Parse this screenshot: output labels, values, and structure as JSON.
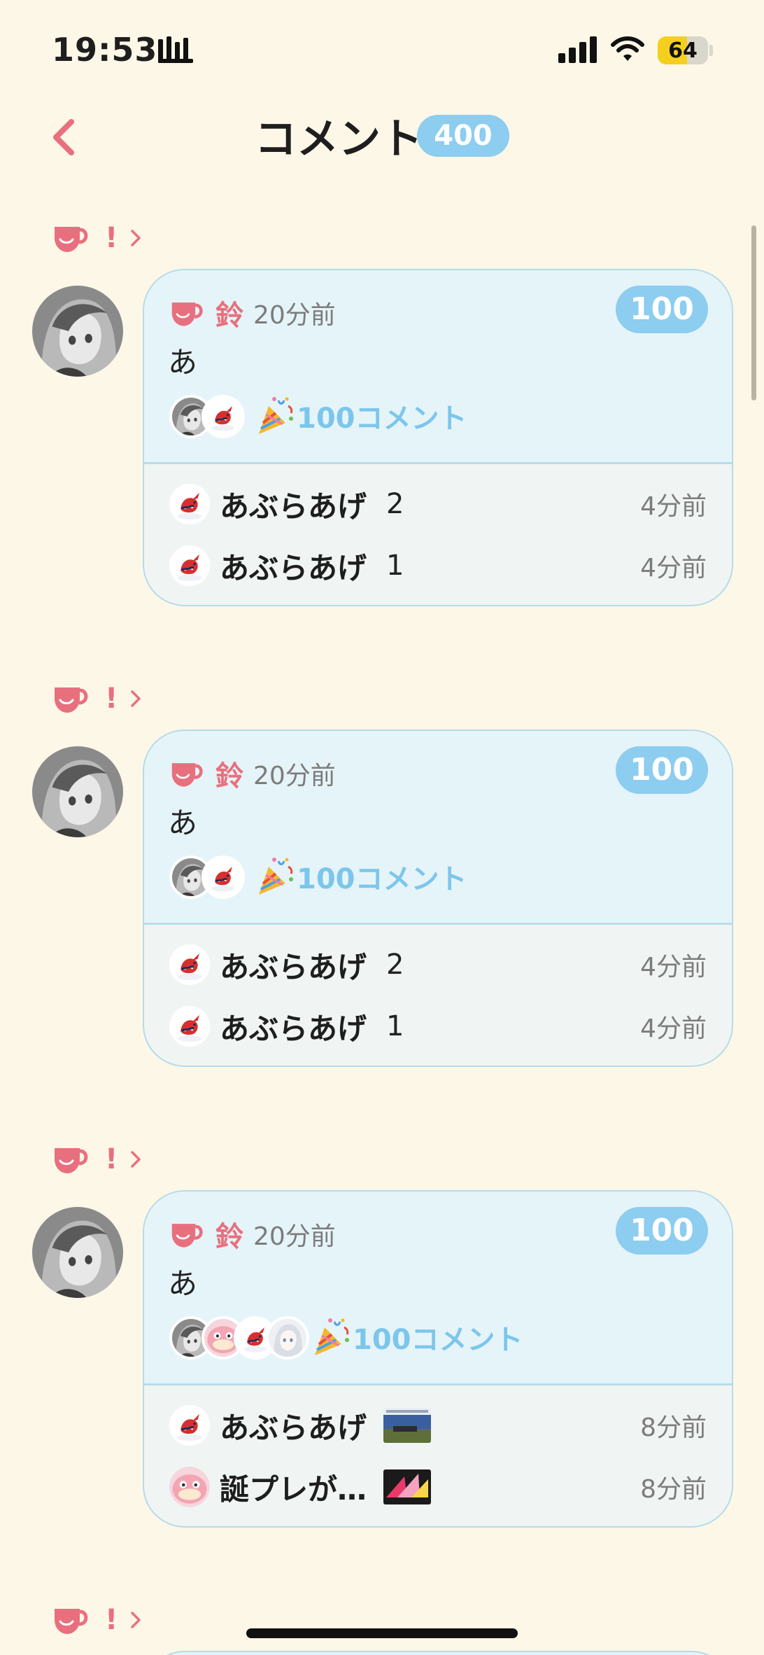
{
  "status_bar": {
    "time": "19:53",
    "battery": "64"
  },
  "header": {
    "title": "コメント",
    "count": "400"
  },
  "threads": [
    {
      "author": "鈴",
      "time_ago": "20分前",
      "likes": "100",
      "text": "あ",
      "milestone": "100コメント",
      "replies": [
        {
          "name": "あぶらあげ",
          "text": "2",
          "time": "4分前"
        },
        {
          "name": "あぶらあげ",
          "text": "1",
          "time": "4分前"
        }
      ]
    },
    {
      "author": "鈴",
      "time_ago": "20分前",
      "likes": "100",
      "text": "あ",
      "milestone": "100コメント",
      "replies": [
        {
          "name": "あぶらあげ",
          "text": "2",
          "time": "4分前"
        },
        {
          "name": "あぶらあげ",
          "text": "1",
          "time": "4分前"
        }
      ]
    },
    {
      "author": "鈴",
      "time_ago": "20分前",
      "likes": "100",
      "text": "あ",
      "milestone": "100コメント",
      "replies": [
        {
          "name": "あぶらあげ",
          "time": "8分前"
        },
        {
          "name": "誕プレが…",
          "time": "8分前"
        }
      ]
    }
  ],
  "thread_header_mark": "!",
  "colors": {
    "accent_pink": "#e8707e",
    "badge_blue": "#8ccdf0",
    "background": "#fdf7e8"
  }
}
